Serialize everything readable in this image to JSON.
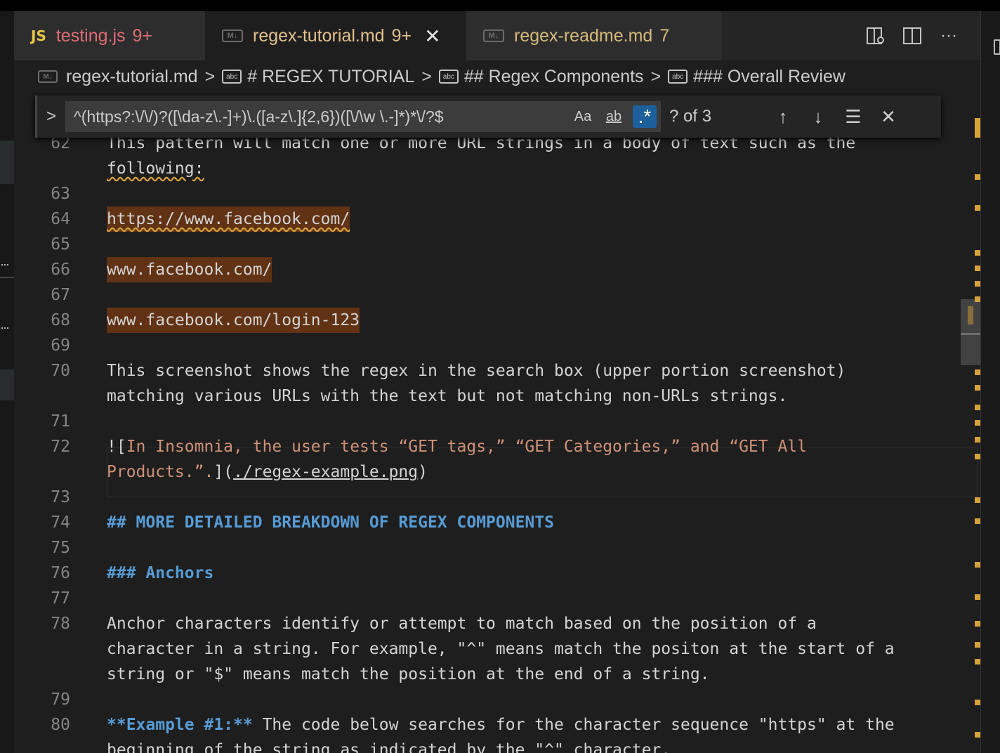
{
  "tabs": [
    {
      "icon": "JS",
      "name": "testing.js",
      "count": "9+",
      "active": false
    },
    {
      "icon": "M↓",
      "name": "regex-tutorial.md",
      "count": "9+",
      "active": true
    },
    {
      "icon": "M↓",
      "name": "regex-readme.md",
      "count": "7",
      "active": false
    }
  ],
  "breadcrumb": {
    "file": "regex-tutorial.md",
    "items": [
      "# REGEX TUTORIAL",
      "## Regex Components",
      "### Overall Review"
    ]
  },
  "find": {
    "query": "^(https?:\\/\\/)?([\\da-z\\.-]+)\\.([a-z\\.]{2,6})([\\/\\w \\.-]*)*\\/?$",
    "match_case_label": "Aa",
    "whole_word_label": "ab",
    "regex_label": ".*",
    "result": "? of 3"
  },
  "lines": [
    {
      "n": "62",
      "t": "This pattern will match one or more URL strings in a body of text such as the"
    },
    {
      "n": "",
      "t": "following:"
    },
    {
      "n": "63",
      "t": ""
    },
    {
      "n": "64",
      "t": "https://www.facebook.com/"
    },
    {
      "n": "65",
      "t": ""
    },
    {
      "n": "66",
      "t": "www.facebook.com/"
    },
    {
      "n": "67",
      "t": ""
    },
    {
      "n": "68",
      "t": "www.facebook.com/login-123"
    },
    {
      "n": "69",
      "t": ""
    },
    {
      "n": "70",
      "t": "This screenshot shows the regex in the search box (upper portion screenshot)"
    },
    {
      "n": "",
      "t": "matching various URLs with the text but not matching non-URLs strings."
    },
    {
      "n": "71",
      "t": ""
    },
    {
      "n": "72",
      "t": "In Insomnia, the user tests “GET tags,” “GET Categories,” and “GET All"
    },
    {
      "n": "",
      "t": "Products.”."
    },
    {
      "n": "73",
      "t": ""
    },
    {
      "n": "74",
      "t": "## MORE DETAILED BREAKDOWN OF REGEX COMPONENTS"
    },
    {
      "n": "75",
      "t": ""
    },
    {
      "n": "76",
      "t": "### Anchors"
    },
    {
      "n": "77",
      "t": ""
    },
    {
      "n": "78",
      "t": "Anchor characters identify or attempt to match based on the position of a"
    },
    {
      "n": "",
      "t": "character in a string. For example, \"^\" means match the positon at the start of a"
    },
    {
      "n": "",
      "t": "string or \"$\" means match the position at the end of a string."
    },
    {
      "n": "79",
      "t": ""
    },
    {
      "n": "80",
      "t": " The code below searches for the character sequence \"https\" at the"
    },
    {
      "n": "",
      "t": "beginning of the string as indicated by the \"^\" character."
    }
  ],
  "img_link": {
    "prefix": "![",
    "close": "](",
    "path": "./regex-example.png",
    "end": ")"
  },
  "example_bold": "**Example #1:**",
  "colors": {
    "accent": "#1d5f9b",
    "match_highlight": "#613214",
    "warning": "#d7a13a"
  }
}
